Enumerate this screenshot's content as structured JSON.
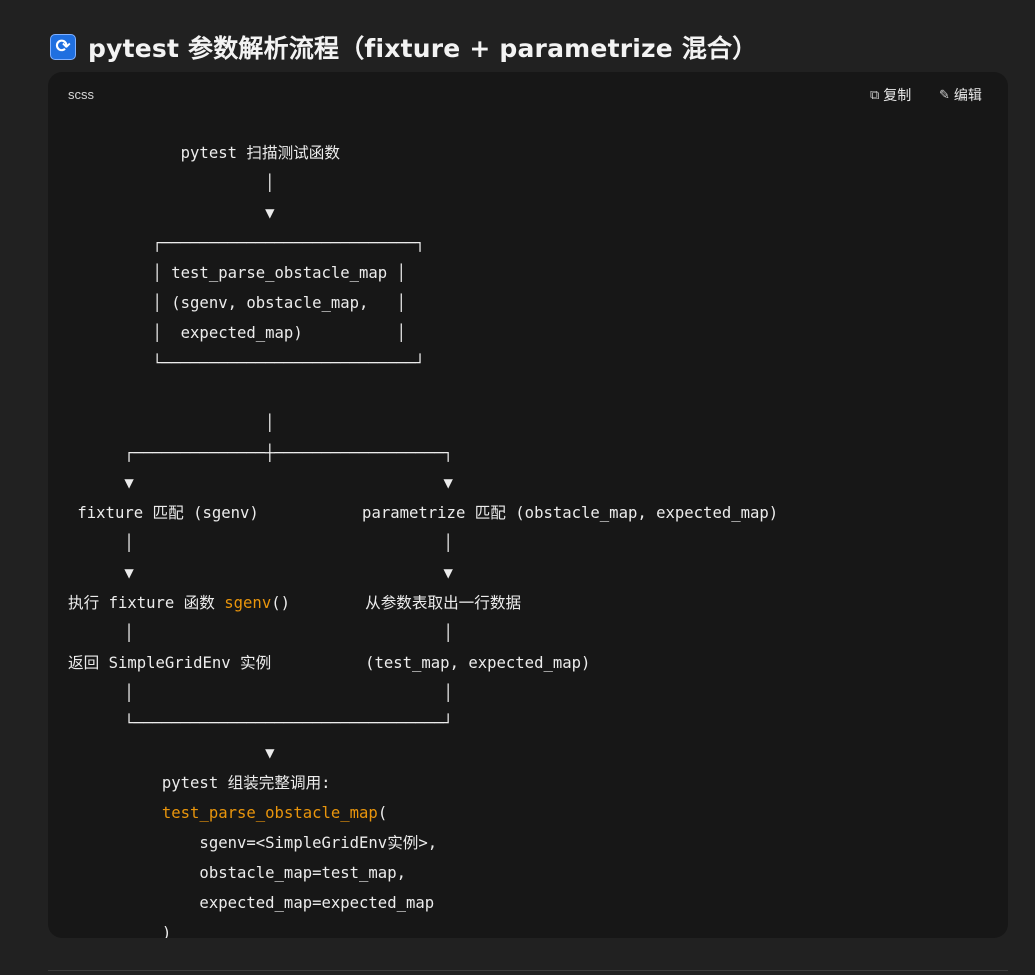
{
  "heading": {
    "icon": "🔄",
    "text": "pytest 参数解析流程（fixture + parametrize 混合）"
  },
  "code_block": {
    "language": "scss",
    "copy_label": "复制",
    "edit_label": "编辑",
    "icons": {
      "copy": "copy-icon",
      "edit": "edit-pencil-icon"
    },
    "highlight_color": "#e9950c",
    "lines": [
      "",
      "            pytest 扫描测试函数",
      "                     │",
      "                     ▼",
      "         ┌───────────────────────────┐",
      "         │ test_parse_obstacle_map │",
      "         │ (sgenv, obstacle_map,   │",
      "         │  expected_map)          │",
      "         └───────────────────────────┘",
      "                     │",
      "      ┌──────────────┼──────────────────┐",
      "      ▼                                 ▼",
      " fixture 匹配 (sgenv)           parametrize 匹配 (obstacle_map, expected_map)",
      "      │                                 │",
      "      ▼                                 ▼",
      "执行 fixture 函数 ",
      "sgenv",
      "()        从参数表取出一行数据",
      "      │                                 │",
      "返回 SimpleGridEnv 实例          (test_map, expected_map)",
      "      │                                 │",
      "      └─────────────────────────────────┘",
      "                     ▼",
      "          pytest 组装完整调用:",
      "test_parse_obstacle_map",
      "(",
      "              sgenv=<SimpleGridEnv实例>,",
      "              obstacle_map=test_map,",
      "              expected_map=expected_map",
      "          )"
    ]
  }
}
